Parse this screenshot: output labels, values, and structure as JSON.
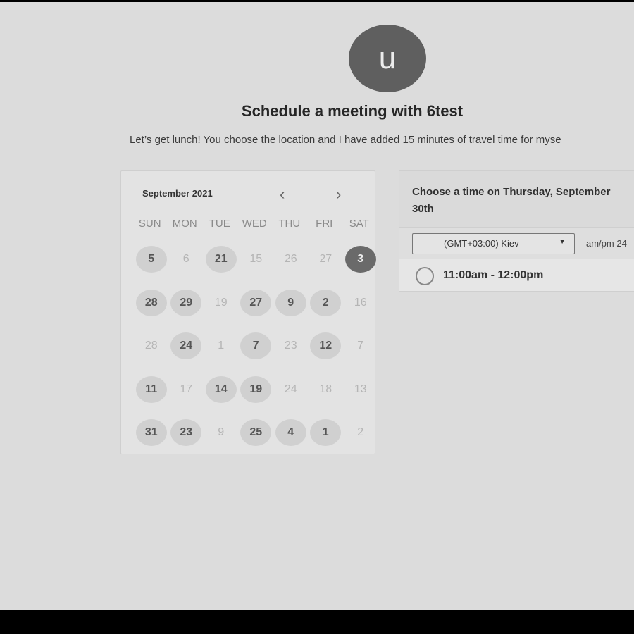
{
  "avatar_letter": "u",
  "title": "Schedule a meeting with 6test",
  "description": "Let’s get lunch! You choose the location and I have added 15 minutes of travel time for myse",
  "calendar": {
    "month": "September 2021",
    "prev": "‹",
    "next": "›",
    "weekdays": [
      "SUN",
      "MON",
      "TUE",
      "WED",
      "THU",
      "FRI",
      "SAT"
    ],
    "weeks": [
      [
        {
          "d": "5",
          "s": "available"
        },
        {
          "d": "6",
          "s": "disabled"
        },
        {
          "d": "21",
          "s": "available"
        },
        {
          "d": "15",
          "s": "disabled"
        },
        {
          "d": "26",
          "s": "disabled"
        },
        {
          "d": "27",
          "s": "disabled"
        },
        {
          "d": "3",
          "s": "selected"
        }
      ],
      [
        {
          "d": "28",
          "s": "available"
        },
        {
          "d": "29",
          "s": "available"
        },
        {
          "d": "19",
          "s": "disabled"
        },
        {
          "d": "27",
          "s": "available"
        },
        {
          "d": "9",
          "s": "available"
        },
        {
          "d": "2",
          "s": "available"
        },
        {
          "d": "16",
          "s": "disabled"
        }
      ],
      [
        {
          "d": "28",
          "s": "disabled"
        },
        {
          "d": "24",
          "s": "available"
        },
        {
          "d": "1",
          "s": "disabled"
        },
        {
          "d": "7",
          "s": "available"
        },
        {
          "d": "23",
          "s": "disabled"
        },
        {
          "d": "12",
          "s": "available"
        },
        {
          "d": "7",
          "s": "disabled"
        }
      ],
      [
        {
          "d": "11",
          "s": "available"
        },
        {
          "d": "17",
          "s": "disabled"
        },
        {
          "d": "14",
          "s": "available"
        },
        {
          "d": "19",
          "s": "available"
        },
        {
          "d": "24",
          "s": "disabled"
        },
        {
          "d": "18",
          "s": "disabled"
        },
        {
          "d": "13",
          "s": "disabled"
        }
      ],
      [
        {
          "d": "31",
          "s": "available"
        },
        {
          "d": "23",
          "s": "available"
        },
        {
          "d": "9",
          "s": "disabled"
        },
        {
          "d": "25",
          "s": "available"
        },
        {
          "d": "4",
          "s": "available"
        },
        {
          "d": "1",
          "s": "available"
        },
        {
          "d": "2",
          "s": "disabled"
        }
      ]
    ]
  },
  "times": {
    "heading": "Choose a time on Thursday, September 30th",
    "timezone": "(GMT+03:00) Kiev",
    "format": "am/pm  24",
    "slots": [
      "11:00am - 12:00pm"
    ]
  }
}
